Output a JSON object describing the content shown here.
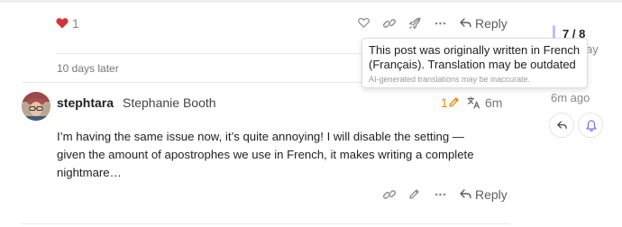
{
  "top_post": {
    "like_count": "1",
    "reply_label": "Reply"
  },
  "gap_label": "10 days later",
  "post": {
    "username": "stephtara",
    "full_name": "Stephanie Booth",
    "edit_count": "1",
    "age": "6m",
    "body": "I’m having the same issue now, it’s quite annoying! I will disable the setting — given the amount of apostrophes we use in French, it makes writing a complete nightmare…",
    "reply_label": "Reply"
  },
  "tooltip": {
    "text": "This post was originally written in French (Français). Translation may be outdated",
    "note": "AI-generated translations may be inaccurate."
  },
  "timeline": {
    "position": "7 / 8",
    "behind_fragment": "ay",
    "last_activity": "6m ago"
  },
  "colors": {
    "heart": "#d6323a",
    "edit_accent": "#e88a0c",
    "timeline_accent": "#c7b8f5",
    "bell_accent": "#8a6cf0"
  },
  "icons": {
    "heart": "heart-icon",
    "like": "heart-outline-icon",
    "link": "link-icon",
    "boost": "rocket-icon",
    "more": "more-icon",
    "reply": "reply-icon",
    "edit": "pencil-icon",
    "translate": "translate-icon",
    "bell": "bell-icon"
  }
}
